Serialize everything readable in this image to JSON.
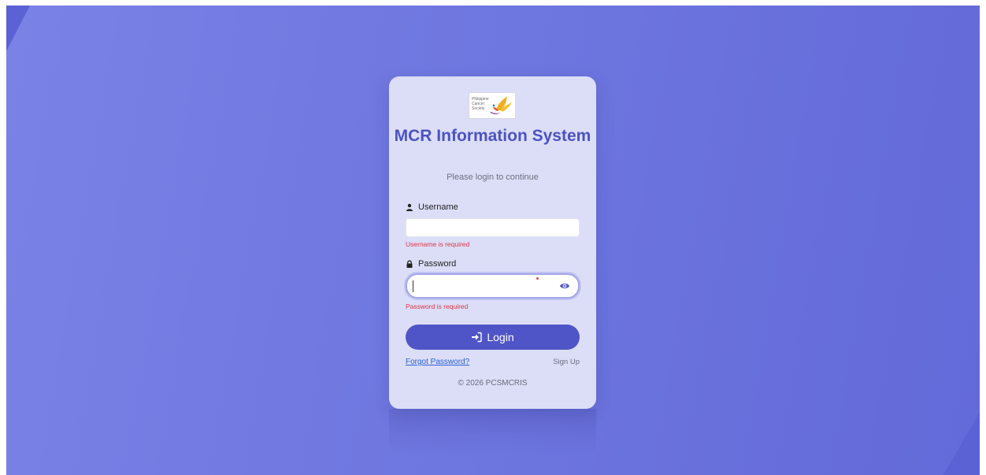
{
  "colors": {
    "background": "#6f77e0",
    "card": "#dcdef8",
    "accent": "#4f55c6",
    "title": "#4b53c1",
    "error": "#dc3545",
    "link": "#2a5fd6"
  },
  "logo": {
    "text": "Philippine\nCancer\nSociety",
    "icon": "phoenix-logo"
  },
  "title": "MCR Information System",
  "subtitle": "Please login to continue",
  "username": {
    "label": "Username",
    "icon": "user-icon",
    "value": "",
    "placeholder": "",
    "error": "Username is required"
  },
  "password": {
    "label": "Password",
    "icon": "lock-icon",
    "value": "",
    "placeholder": "",
    "toggle_icon": "eye-icon",
    "error": "Password is required"
  },
  "login_button": {
    "label": "Login",
    "icon": "sign-in-icon"
  },
  "links": {
    "forgot_password": "Forgot Password?",
    "sign_up": "Sign Up"
  },
  "footer": "© 2026 PCSMCRIS"
}
